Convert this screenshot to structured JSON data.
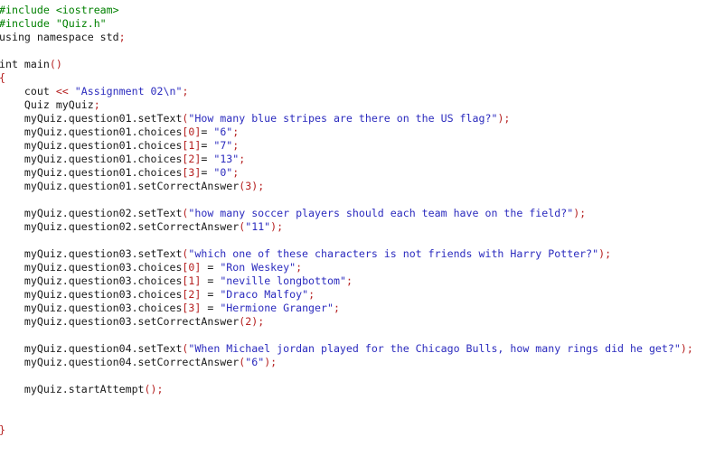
{
  "editor": {
    "language": "C++",
    "background_color": "#ffffff",
    "font_size_px": 11.6,
    "line_height_px": 15,
    "colors": {
      "preprocessor": "#008000",
      "identifier": "#1a1a1a",
      "string": "#2b2bbe",
      "punctuation": "#b52020",
      "number": "#b52020"
    }
  },
  "code": {
    "lines": [
      {
        "id": "line-1",
        "tokens": [
          {
            "t": "#include <iostream>",
            "c": "pre"
          }
        ]
      },
      {
        "id": "line-2",
        "tokens": [
          {
            "t": "#include \"Quiz.h\"",
            "c": "pre"
          }
        ]
      },
      {
        "id": "line-3",
        "tokens": [
          {
            "t": "using namespace std",
            "c": "plain"
          },
          {
            "t": ";",
            "c": "punc"
          }
        ]
      },
      {
        "id": "line-4",
        "tokens": []
      },
      {
        "id": "line-5",
        "tokens": [
          {
            "t": "int main",
            "c": "plain"
          },
          {
            "t": "()",
            "c": "punc"
          }
        ]
      },
      {
        "id": "line-6",
        "tokens": [
          {
            "t": "{",
            "c": "brace"
          }
        ]
      },
      {
        "id": "line-7",
        "tokens": [
          {
            "t": "    cout ",
            "c": "plain"
          },
          {
            "t": "<<",
            "c": "punc"
          },
          {
            "t": " ",
            "c": "plain"
          },
          {
            "t": "\"Assignment 02\\n\"",
            "c": "str"
          },
          {
            "t": ";",
            "c": "punc"
          }
        ]
      },
      {
        "id": "line-8",
        "tokens": [
          {
            "t": "    Quiz myQuiz",
            "c": "plain"
          },
          {
            "t": ";",
            "c": "punc"
          }
        ]
      },
      {
        "id": "line-9",
        "tokens": [
          {
            "t": "    myQuiz.question01.setText",
            "c": "plain"
          },
          {
            "t": "(",
            "c": "punc"
          },
          {
            "t": "\"How many blue stripes are there on the US flag?\"",
            "c": "str"
          },
          {
            "t": ");",
            "c": "punc"
          }
        ]
      },
      {
        "id": "line-10",
        "tokens": [
          {
            "t": "    myQuiz.question01.choices",
            "c": "plain"
          },
          {
            "t": "[0]",
            "c": "num"
          },
          {
            "t": "= ",
            "c": "plain"
          },
          {
            "t": "\"6\"",
            "c": "str"
          },
          {
            "t": ";",
            "c": "punc"
          }
        ]
      },
      {
        "id": "line-11",
        "tokens": [
          {
            "t": "    myQuiz.question01.choices",
            "c": "plain"
          },
          {
            "t": "[1]",
            "c": "num"
          },
          {
            "t": "= ",
            "c": "plain"
          },
          {
            "t": "\"7\"",
            "c": "str"
          },
          {
            "t": ";",
            "c": "punc"
          }
        ]
      },
      {
        "id": "line-12",
        "tokens": [
          {
            "t": "    myQuiz.question01.choices",
            "c": "plain"
          },
          {
            "t": "[2]",
            "c": "num"
          },
          {
            "t": "= ",
            "c": "plain"
          },
          {
            "t": "\"13\"",
            "c": "str"
          },
          {
            "t": ";",
            "c": "punc"
          }
        ]
      },
      {
        "id": "line-13",
        "tokens": [
          {
            "t": "    myQuiz.question01.choices",
            "c": "plain"
          },
          {
            "t": "[3]",
            "c": "num"
          },
          {
            "t": "= ",
            "c": "plain"
          },
          {
            "t": "\"0\"",
            "c": "str"
          },
          {
            "t": ";",
            "c": "punc"
          }
        ]
      },
      {
        "id": "line-14",
        "tokens": [
          {
            "t": "    myQuiz.question01.setCorrectAnswer",
            "c": "plain"
          },
          {
            "t": "(3);",
            "c": "punc"
          }
        ]
      },
      {
        "id": "line-15",
        "tokens": []
      },
      {
        "id": "line-16",
        "tokens": [
          {
            "t": "    myQuiz.question02.setText",
            "c": "plain"
          },
          {
            "t": "(",
            "c": "punc"
          },
          {
            "t": "\"how many soccer players should each team have on the field?\"",
            "c": "str"
          },
          {
            "t": ");",
            "c": "punc"
          }
        ]
      },
      {
        "id": "line-17",
        "tokens": [
          {
            "t": "    myQuiz.question02.setCorrectAnswer",
            "c": "plain"
          },
          {
            "t": "(",
            "c": "punc"
          },
          {
            "t": "\"11\"",
            "c": "str"
          },
          {
            "t": ");",
            "c": "punc"
          }
        ]
      },
      {
        "id": "line-18",
        "tokens": []
      },
      {
        "id": "line-19",
        "tokens": [
          {
            "t": "    myQuiz.question03.setText",
            "c": "plain"
          },
          {
            "t": "(",
            "c": "punc"
          },
          {
            "t": "\"which one of these characters is not friends with Harry Potter?\"",
            "c": "str"
          },
          {
            "t": ");",
            "c": "punc"
          }
        ]
      },
      {
        "id": "line-20",
        "tokens": [
          {
            "t": "    myQuiz.question03.choices",
            "c": "plain"
          },
          {
            "t": "[0]",
            "c": "num"
          },
          {
            "t": " = ",
            "c": "plain"
          },
          {
            "t": "\"Ron Weskey\"",
            "c": "str"
          },
          {
            "t": ";",
            "c": "punc"
          }
        ]
      },
      {
        "id": "line-21",
        "tokens": [
          {
            "t": "    myQuiz.question03.choices",
            "c": "plain"
          },
          {
            "t": "[1]",
            "c": "num"
          },
          {
            "t": " = ",
            "c": "plain"
          },
          {
            "t": "\"neville longbottom\"",
            "c": "str"
          },
          {
            "t": ";",
            "c": "punc"
          }
        ]
      },
      {
        "id": "line-22",
        "tokens": [
          {
            "t": "    myQuiz.question03.choices",
            "c": "plain"
          },
          {
            "t": "[2]",
            "c": "num"
          },
          {
            "t": " = ",
            "c": "plain"
          },
          {
            "t": "\"Draco Malfoy\"",
            "c": "str"
          },
          {
            "t": ";",
            "c": "punc"
          }
        ]
      },
      {
        "id": "line-23",
        "tokens": [
          {
            "t": "    myQuiz.question03.choices",
            "c": "plain"
          },
          {
            "t": "[3]",
            "c": "num"
          },
          {
            "t": " = ",
            "c": "plain"
          },
          {
            "t": "\"Hermione Granger\"",
            "c": "str"
          },
          {
            "t": ";",
            "c": "punc"
          }
        ]
      },
      {
        "id": "line-24",
        "tokens": [
          {
            "t": "    myQuiz.question03.setCorrectAnswer",
            "c": "plain"
          },
          {
            "t": "(2);",
            "c": "punc"
          }
        ]
      },
      {
        "id": "line-25",
        "tokens": []
      },
      {
        "id": "line-26",
        "tokens": [
          {
            "t": "    myQuiz.question04.setText",
            "c": "plain"
          },
          {
            "t": "(",
            "c": "punc"
          },
          {
            "t": "\"When Michael jordan played for the Chicago Bulls, how many rings did he get?\"",
            "c": "str"
          },
          {
            "t": ");",
            "c": "punc"
          }
        ]
      },
      {
        "id": "line-27",
        "tokens": [
          {
            "t": "    myQuiz.question04.setCorrectAnswer",
            "c": "plain"
          },
          {
            "t": "(",
            "c": "punc"
          },
          {
            "t": "\"6\"",
            "c": "str"
          },
          {
            "t": ");",
            "c": "punc"
          }
        ]
      },
      {
        "id": "line-28",
        "tokens": []
      },
      {
        "id": "line-29",
        "tokens": [
          {
            "t": "    myQuiz.startAttempt",
            "c": "plain"
          },
          {
            "t": "();",
            "c": "punc"
          }
        ]
      },
      {
        "id": "line-30",
        "tokens": []
      },
      {
        "id": "line-31",
        "tokens": []
      },
      {
        "id": "line-32",
        "tokens": [
          {
            "t": "}",
            "c": "brace"
          }
        ]
      }
    ]
  }
}
